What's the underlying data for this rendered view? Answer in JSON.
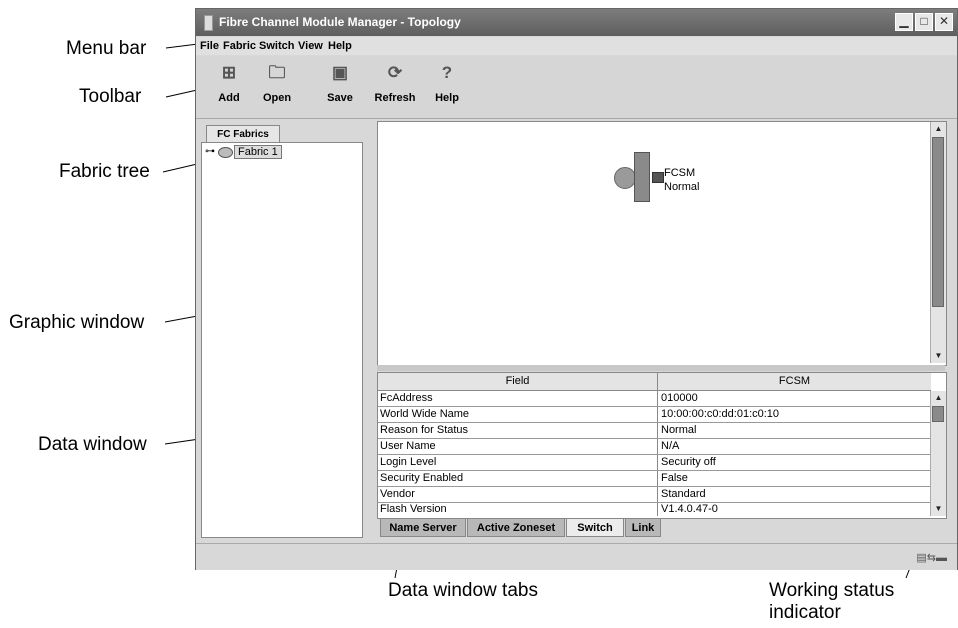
{
  "callouts": {
    "menu_bar": "Menu bar",
    "toolbar": "Toolbar",
    "fabric_tree": "Fabric tree",
    "graphic_window": "Graphic window",
    "data_window": "Data window",
    "data_window_tabs": "Data window tabs",
    "working_status_line1": "Working status",
    "working_status_line2": "indicator"
  },
  "window": {
    "title": "Fibre Channel Module Manager - Topology",
    "controls": {
      "minimize": "▁",
      "maximize": "□",
      "close": "✕"
    }
  },
  "menu": [
    "File",
    "Fabric",
    "Switch",
    "View",
    "Help"
  ],
  "toolbar": [
    {
      "label": "Add",
      "icon": "add-icon"
    },
    {
      "label": "Open",
      "icon": "open-folder-icon"
    },
    {
      "label": "Save",
      "icon": "floppy-disk-icon"
    },
    {
      "label": "Refresh",
      "icon": "refresh-icon"
    },
    {
      "label": "Help",
      "icon": "help-icon"
    }
  ],
  "tree": {
    "tab": "FC Fabrics",
    "items": [
      {
        "label": "Fabric 1",
        "icon": "fabric-icon"
      }
    ]
  },
  "graphic": {
    "switch_name": "FCSM",
    "switch_status": "Normal"
  },
  "table": {
    "columns": [
      "Field",
      "FCSM"
    ],
    "rows": [
      [
        "FcAddress",
        "010000"
      ],
      [
        "World Wide Name",
        "10:00:00:c0:dd:01:c0:10"
      ],
      [
        "Reason for Status",
        "Normal"
      ],
      [
        "User Name",
        "N/A"
      ],
      [
        "Login Level",
        "Security off"
      ],
      [
        "Security Enabled",
        "False"
      ],
      [
        "Vendor",
        "Standard"
      ],
      [
        "Flash Version",
        "V1.4.0.47-0"
      ]
    ]
  },
  "data_tabs": [
    "Name Server",
    "Active Zoneset",
    "Switch",
    "Link"
  ],
  "active_tab": "Switch",
  "status_indicator_icon": "working-status-icon"
}
